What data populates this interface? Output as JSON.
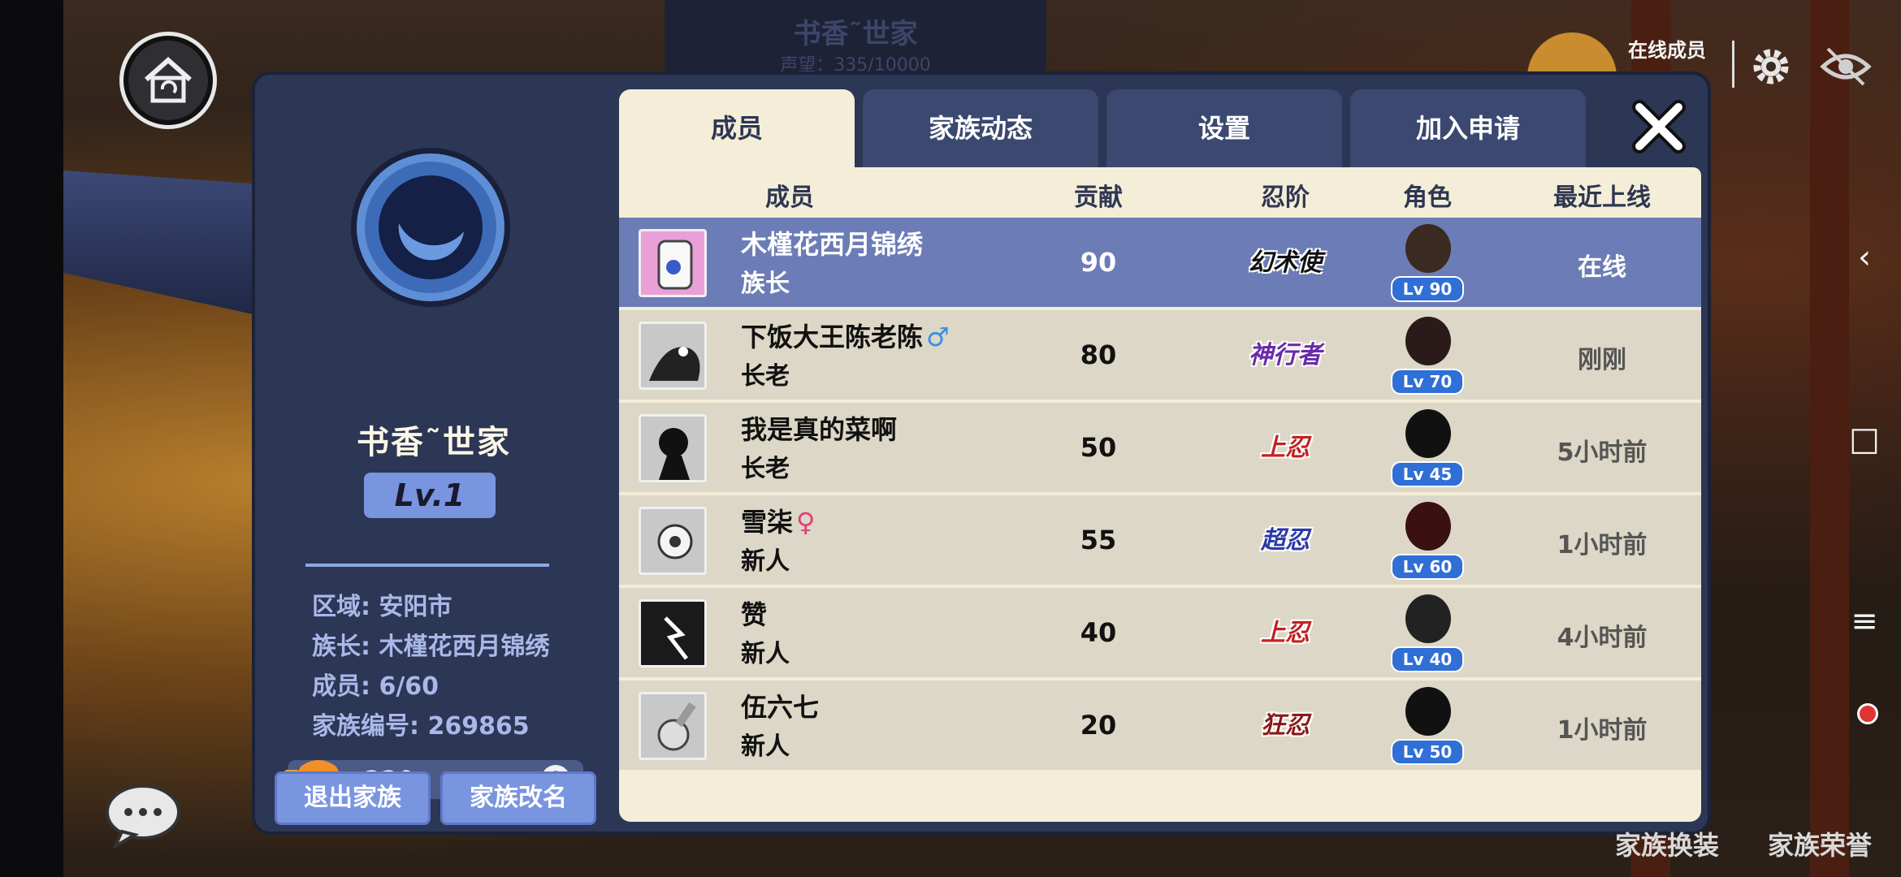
{
  "background": {
    "banner_title": "书香˜世家",
    "banner_sub": "声望：335/10000"
  },
  "hud": {
    "online_label": "在线成员"
  },
  "family": {
    "name": "书香˜世家",
    "level": "Lv.1",
    "region": "区域: 安阳市",
    "leader": "族长: 木槿花西月锦绣",
    "members": "成员: 6/60",
    "family_id": "家族编号: 269865",
    "coins": "220",
    "coin_info_icon": "i",
    "leave_label": "退出家族",
    "rename_label": "家族改名"
  },
  "tabs": [
    {
      "label": "成员",
      "active": true
    },
    {
      "label": "家族动态",
      "active": false
    },
    {
      "label": "设置",
      "active": false
    },
    {
      "label": "加入申请",
      "active": false
    }
  ],
  "table": {
    "headers": {
      "member": "成员",
      "contribution": "贡献",
      "rank": "忍阶",
      "character": "角色",
      "last_online": "最近上线"
    },
    "rows": [
      {
        "name": "木槿花西月锦绣",
        "gender": "",
        "role": "族长",
        "contribution": "90",
        "rank": "幻术使",
        "level": "Lv 90",
        "last": "在线",
        "self": true
      },
      {
        "name": "下饭大王陈老陈",
        "gender": "♂",
        "role": "长老",
        "contribution": "80",
        "rank": "神行者",
        "level": "Lv 70",
        "last": "刚刚",
        "self": false
      },
      {
        "name": "我是真的菜啊",
        "gender": "",
        "role": "长老",
        "contribution": "50",
        "rank": "上忍",
        "level": "Lv 45",
        "last": "5小时前",
        "self": false
      },
      {
        "name": "雪柒",
        "gender": "♀",
        "role": "新人",
        "contribution": "55",
        "rank": "超忍",
        "level": "Lv 60",
        "last": "1小时前",
        "self": false
      },
      {
        "name": "赞",
        "gender": "",
        "role": "新人",
        "contribution": "40",
        "rank": "上忍",
        "level": "Lv 40",
        "last": "4小时前",
        "self": false
      },
      {
        "name": "伍六七",
        "gender": "",
        "role": "新人",
        "contribution": "20",
        "rank": "狂忍",
        "level": "Lv 50",
        "last": "1小时前",
        "self": false
      }
    ]
  },
  "bottom": {
    "outfit_label": "家族换装",
    "honor_label": "家族荣誉"
  },
  "system_bar": {
    "back_icon": "‹",
    "home_icon": "□",
    "menu_icon": "≡"
  },
  "colors": {
    "panel": "#2c3655",
    "accent": "#7a95e0",
    "table_bg": "#f4eed8",
    "self_row": "#6c7cb6",
    "level_badge": "#2f6fd6"
  }
}
